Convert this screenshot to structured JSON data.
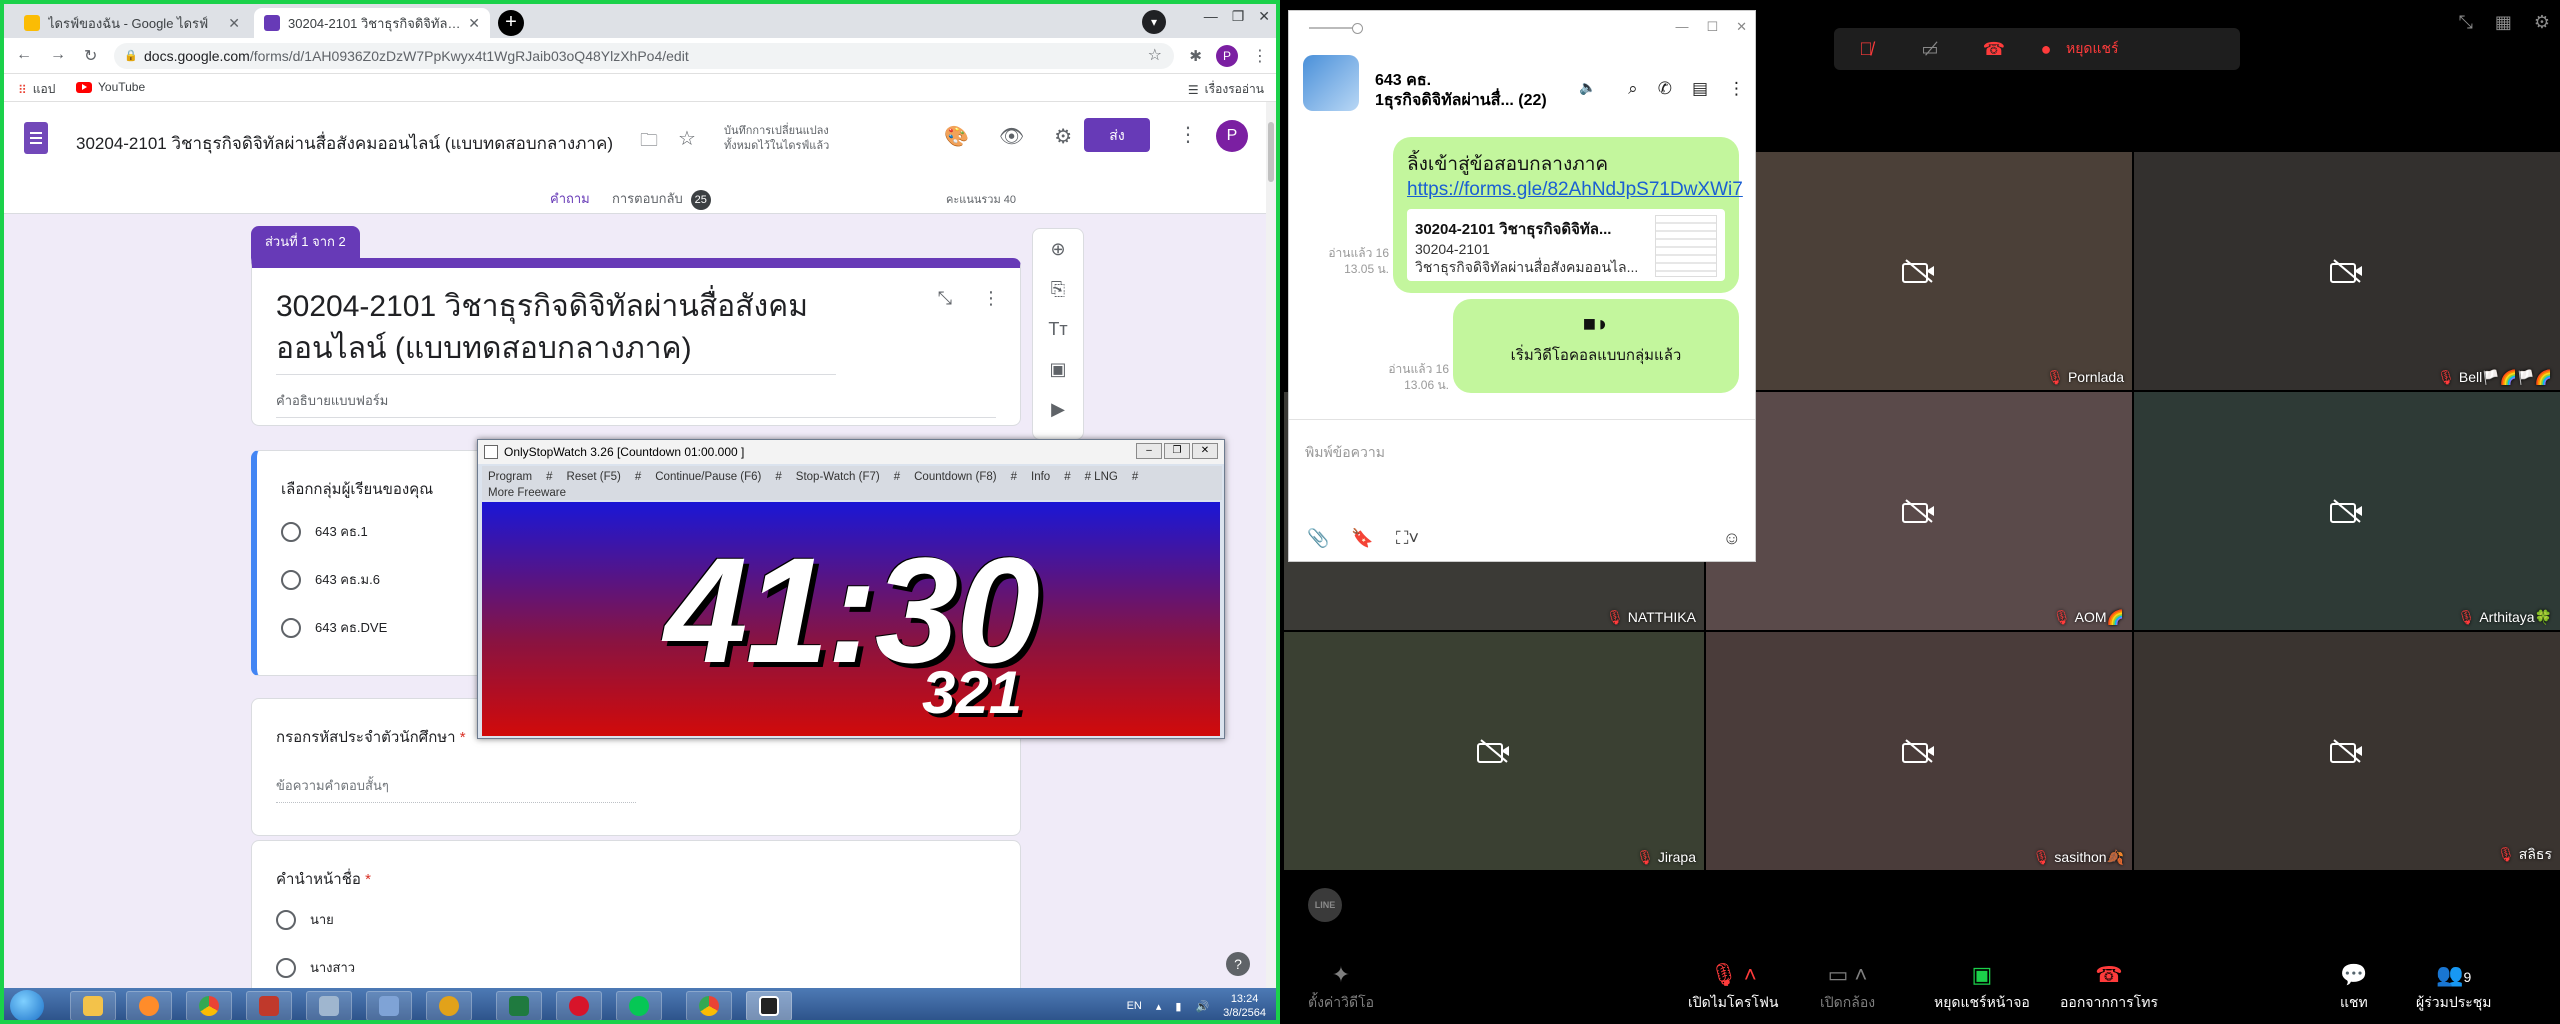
{
  "browser": {
    "tabs": [
      {
        "label": "ไดรฟ์ของฉัน - Google ไดรฟ์",
        "favicon_color": "#fbbc04"
      },
      {
        "label": "30204-2101 วิชาธุรกิจดิจิทัลผ่านสื่อฯ",
        "favicon_color": "#673ab7"
      }
    ],
    "url_domain": "docs.google.com",
    "url_path": "/forms/d/1AH0936Z0zDzW7PpKwyx4t1WgRJaib03oQ48YlzXhPo4/edit",
    "profile_initial": "P",
    "bookmarks": [
      {
        "label": "แอป"
      },
      {
        "label": "YouTube"
      }
    ],
    "reading_list": "เรื่องรออ่าน"
  },
  "form": {
    "doc_title": "30204-2101 วิชาธุรกิจดิจิทัลผ่านสื่อสังคมออนไลน์ (แบบทดสอบกลางภาค)",
    "save_note": "บันทึกการเปลี่ยนแปลงทั้งหมดไว้ในไดรฟ์แล้ว",
    "send_label": "ส่ง",
    "profile_initial": "P",
    "tab_questions": "คำถาม",
    "tab_responses": "การตอบกลับ",
    "responses_count": "25",
    "total_points": "คะแนนรวม 40",
    "section_label": "ส่วนที่ 1 จาก 2",
    "title_line1": "30204-2101 วิชาธุรกิจดิจิทัลผ่านสื่อสังคม",
    "title_line2": "ออนไลน์ (แบบทดสอบกลางภาค)",
    "description_placeholder": "คำอธิบายแบบฟอร์ม",
    "q1": {
      "title": "เลือกกลุ่มผู้เรียนของคุณ",
      "options": [
        "643 คธ.1",
        "643 คธ.ม.6",
        "643 คธ.DVE"
      ]
    },
    "q2": {
      "title": "กรอกรหัสประจำตัวนักศึกษา",
      "required_mark": "*",
      "placeholder": "ข้อความคำตอบสั้นๆ"
    },
    "q3": {
      "title": "คำนำหน้าชื่อ",
      "required_mark": "*",
      "options": [
        "นาย",
        "นางสาว"
      ]
    }
  },
  "taskbar": {
    "lang": "EN",
    "time": "13:24",
    "date": "3/8/2564"
  },
  "stopwatch": {
    "window_title": "OnlyStopWatch 3.26  [Countdown  01:00.000 ]",
    "menu": [
      "Program",
      "#",
      "Reset (F5)",
      "#",
      "Continue/Pause (F6)",
      "#",
      "Stop-Watch (F7)",
      "#",
      "Countdown (F8)",
      "#",
      "Info",
      "#",
      "# LNG",
      "#"
    ],
    "menu2": "More Freeware",
    "main_time": "41:30",
    "sub_time": "321"
  },
  "meeting": {
    "top_controls": {
      "stop_share": "หยุดแชร์"
    },
    "participants": [
      {
        "name": "Pornlada",
        "bg": "#4b4038"
      },
      {
        "name": "Bell🏳️🌈🏳️🌈",
        "bg": "#33302e"
      },
      {
        "name": "NATTHIKA",
        "bg": "#3b3a36"
      },
      {
        "name": "AOM🌈",
        "bg": "#5a4a4a"
      },
      {
        "name": "Arthitaya🍀",
        "bg": "#2e3a36"
      },
      {
        "name": "Jirapa",
        "bg": "#3a4032"
      },
      {
        "name": "sasithon🍂",
        "bg": "#4a3c3a"
      },
      {
        "name": "สลิธร",
        "bg": "#3a3430"
      }
    ],
    "bottom": {
      "effects": "ตั้งค่าวิดีโอ",
      "mic": "เปิดไมโครโฟน",
      "camera": "เปิดกล้อง",
      "share": "หยุดแชร์หน้าจอ",
      "leave": "ออกจากการโทร",
      "chat": "แชท",
      "members": "ผู้ร่วมประชุม",
      "members_count": "9"
    },
    "line_logo": "LINE"
  },
  "chat": {
    "group_line1": "643 คธ.",
    "group_line2": "1ธุรกิจดิจิทัลผ่านสื่... (22)",
    "msg1_text": "ลิ้งเข้าสู่ข้อสอบกลางภาค ",
    "msg1_link": "https://forms.gle/82AhNdJpS71DwXWi7",
    "preview_title": "30204-2101 วิชาธุรกิจดิจิทัล...",
    "preview_line1": "30204-2101",
    "preview_line2": "วิชาธุรกิจดิจิทัลผ่านสื่อสังคมออนไล...",
    "read1_line1": "อ่านแล้ว 16",
    "read1_line2": "13.05 น.",
    "msg2_text": "เริ่มวิดีโอคอลแบบกลุ่มแล้ว",
    "read2_line1": "อ่านแล้ว 16",
    "read2_line2": "13.06 น.",
    "input_placeholder": "พิมพ์ข้อความ"
  },
  "colors": {
    "share_frame": "#1bd14a",
    "forms_purple": "#673ab7",
    "chat_bubble": "#c3f69d"
  }
}
